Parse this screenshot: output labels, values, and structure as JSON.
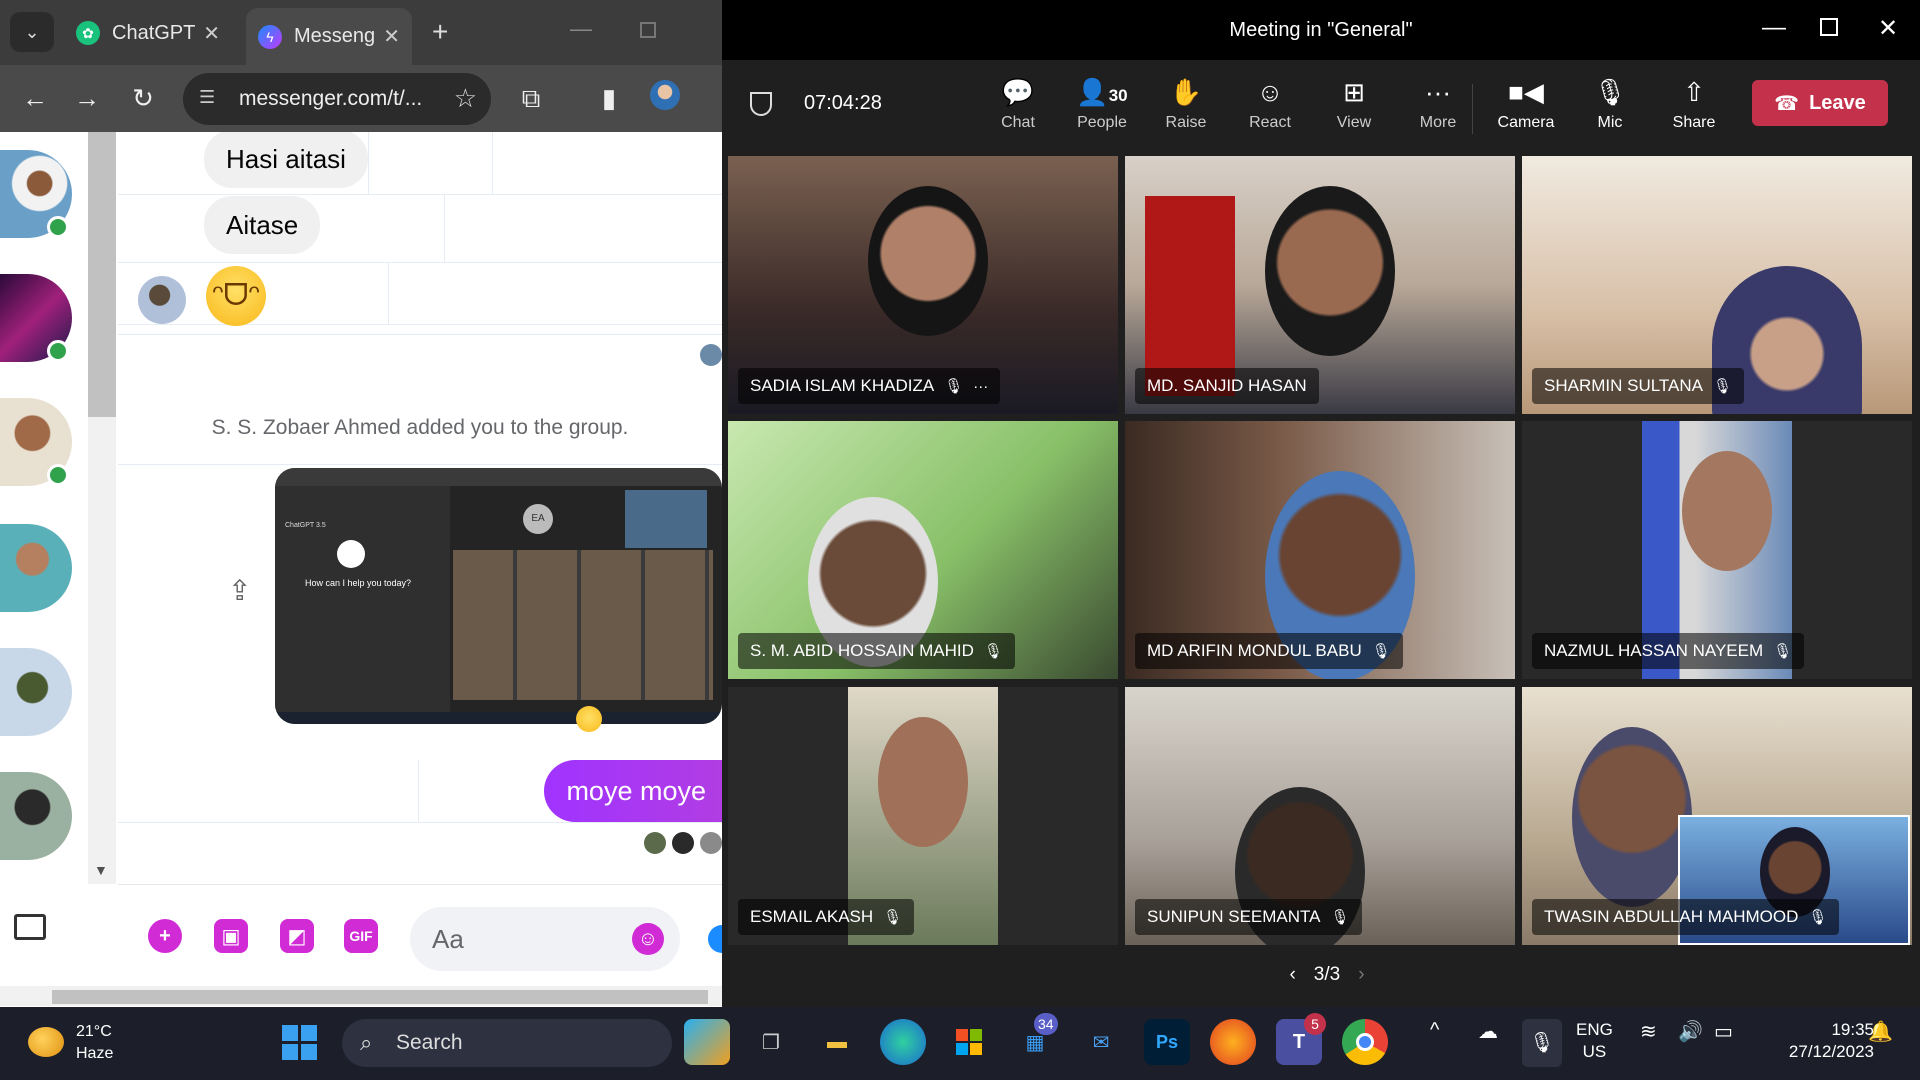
{
  "chrome": {
    "tabs": [
      {
        "title": "ChatGPT",
        "icon": "chatgpt-icon"
      },
      {
        "title": "Messeng",
        "icon": "messenger-icon"
      }
    ],
    "url": "messenger.com/t/..."
  },
  "messenger": {
    "messages": {
      "m1": "Hasi aitasi",
      "m2": "Aitase",
      "system": "S. S. Zobaer Ahmed added you to the group.",
      "mine": "moye moye"
    },
    "composer_placeholder": "Aa",
    "gif_label": "GIF",
    "thumb": {
      "prompt": "How can I help you today?",
      "model": "ChatGPT 3.5",
      "initials": "EA"
    }
  },
  "teams": {
    "title": "Meeting in \"General\"",
    "timer": "07:04:28",
    "toolbar": {
      "chat": "Chat",
      "people": "People",
      "people_count": "30",
      "raise": "Raise",
      "react": "React",
      "view": "View",
      "more": "More",
      "camera": "Camera",
      "mic": "Mic",
      "share": "Share",
      "leave": "Leave"
    },
    "participants": [
      "SADIA ISLAM KHADIZA",
      "MD. SANJID HASAN",
      "SHARMIN SULTANA",
      "S. M. ABID HOSSAIN MAHID",
      "MD ARIFIN MONDUL BABU",
      "NAZMUL HASSAN NAYEEM",
      "ESMAIL AKASH",
      "SUNIPUN SEEMANTA",
      "TWASIN ABDULLAH MAHMOOD"
    ],
    "page": "3/3"
  },
  "taskbar": {
    "temp": "21°C",
    "weather": "Haze",
    "search": "Search",
    "mail_badge": "34",
    "teams_badge": "5",
    "lang1": "ENG",
    "lang2": "US",
    "time": "19:35",
    "date": "27/12/2023"
  }
}
